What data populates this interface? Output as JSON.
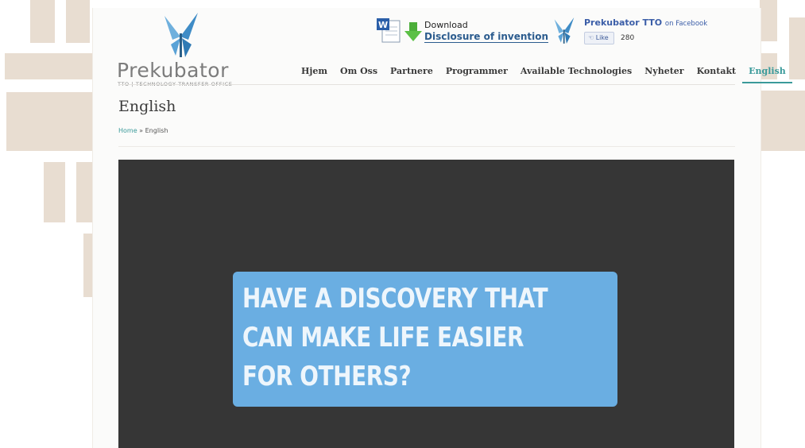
{
  "logo": {
    "name": "Prekubator",
    "subtitle": "TTO | TECHNOLOGY TRANSFER OFFICE",
    "icon": "butterfly-logo-icon",
    "accent": "#4a9ad4"
  },
  "download": {
    "title": "Download",
    "link_label": "Disclosure of invention",
    "icons": [
      "word-document-icon",
      "download-arrow-icon"
    ]
  },
  "facebook": {
    "name": "Prekubator TTO",
    "suffix": "on Facebook",
    "like_label": "Like",
    "like_count": "280",
    "icon": "thumbs-up-icon"
  },
  "nav": {
    "items": [
      {
        "label": "Hjem"
      },
      {
        "label": "Om Oss"
      },
      {
        "label": "Partnere"
      },
      {
        "label": "Programmer"
      },
      {
        "label": "Available Technologies"
      },
      {
        "label": "Nyheter"
      },
      {
        "label": "Kontakt"
      },
      {
        "label": "English",
        "active": true
      }
    ]
  },
  "page": {
    "title": "English",
    "breadcrumb": {
      "home": "Home",
      "separator": "»",
      "current": "English"
    }
  },
  "video": {
    "background": "#363636",
    "callout_color": "#6aaee2",
    "lines": [
      "HAVE A DISCOVERY THAT",
      "CAN MAKE LIFE EASIER",
      "FOR OTHERS?"
    ]
  },
  "colors": {
    "active_nav": "#3a9a9a",
    "link": "#2c5c8e",
    "facebook": "#3b5ea8"
  }
}
